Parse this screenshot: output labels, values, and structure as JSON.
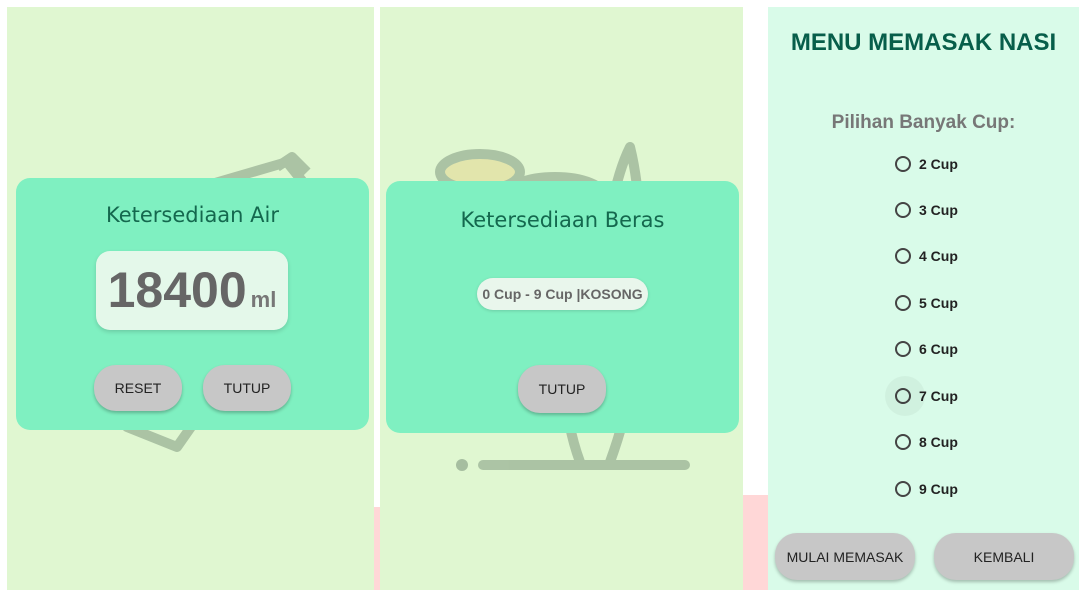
{
  "panel_air": {
    "title": "Ketersediaan Air",
    "value": "18400",
    "unit": "ml",
    "reset_label": "RESET",
    "close_label": "TUTUP"
  },
  "panel_beras": {
    "title": "Ketersediaan Beras",
    "status": "0 Cup - 9 Cup |KOSONG",
    "close_label": "TUTUP"
  },
  "panel_menu": {
    "title": "MENU MEMASAK NASI",
    "cup_label": "Pilihan Banyak Cup:",
    "options": [
      "2 Cup",
      "3 Cup",
      "4 Cup",
      "5 Cup",
      "6 Cup",
      "7 Cup",
      "8 Cup",
      "9 Cup"
    ],
    "start_label": "MULAI MEMASAK",
    "back_label": "KEMBALI"
  },
  "colors": {
    "background_green": "#e0f7d1",
    "dialog_green": "#7ff0c1",
    "menu_background": "#d9fbe9",
    "title_dark_green": "#075e4a",
    "button_gray": "#c7c7c7"
  },
  "icons": [
    "water-bottle-illustration",
    "rice-plant-illustration",
    "radio-button-icon"
  ]
}
